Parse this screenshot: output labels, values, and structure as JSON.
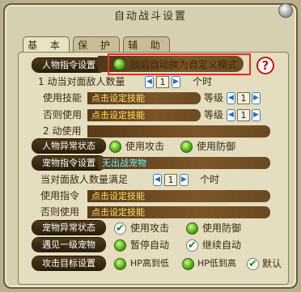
{
  "window": {
    "title": "自动战斗设置"
  },
  "tabs": [
    {
      "label": "基 本"
    },
    {
      "label": "保 护"
    },
    {
      "label": "辅 助"
    }
  ],
  "person_cmd": {
    "category": "人物指令设置",
    "auto_custom_label": "战后自动换为自定义模式",
    "line1_prefix": "1 动当对面敌人数量",
    "line1_value": "1",
    "line1_suffix": "个时",
    "use_skill_label": "使用技能",
    "use_skill_value": "点击设定技能",
    "level_label_1": "等级",
    "level_value_1": "1",
    "else_use_label": "否则使用",
    "else_use_value": "点击设定技能",
    "level_label_2": "等级",
    "level_value_2": "1",
    "line2_label": "2 动使用"
  },
  "person_abnormal": {
    "category": "人物异常状态",
    "opt1": "使用攻击",
    "opt2": "使用防御"
  },
  "pet_cmd": {
    "category": "宠物指令设置",
    "pet_value": "无出战宠物",
    "enemy_prefix": "当对面敌人数量满足",
    "enemy_value": "1",
    "enemy_suffix": "个时",
    "use_cmd_label": "使用指令",
    "use_cmd_value": "点击设定技能",
    "else_use_label": "否则使用",
    "else_use_value": "点击设定技能"
  },
  "pet_abnormal": {
    "category": "宠物异常状态",
    "opt1": "使用攻击",
    "opt2": "使用防御"
  },
  "level1_pet": {
    "category": "遇见一级宠物",
    "opt1": "暂停自动",
    "opt2": "继续自动"
  },
  "target": {
    "category": "攻击目标设置",
    "opt1": "HP高到低",
    "opt2": "HP低到高",
    "opt3": "默认"
  },
  "help": {
    "glyph": "?"
  }
}
